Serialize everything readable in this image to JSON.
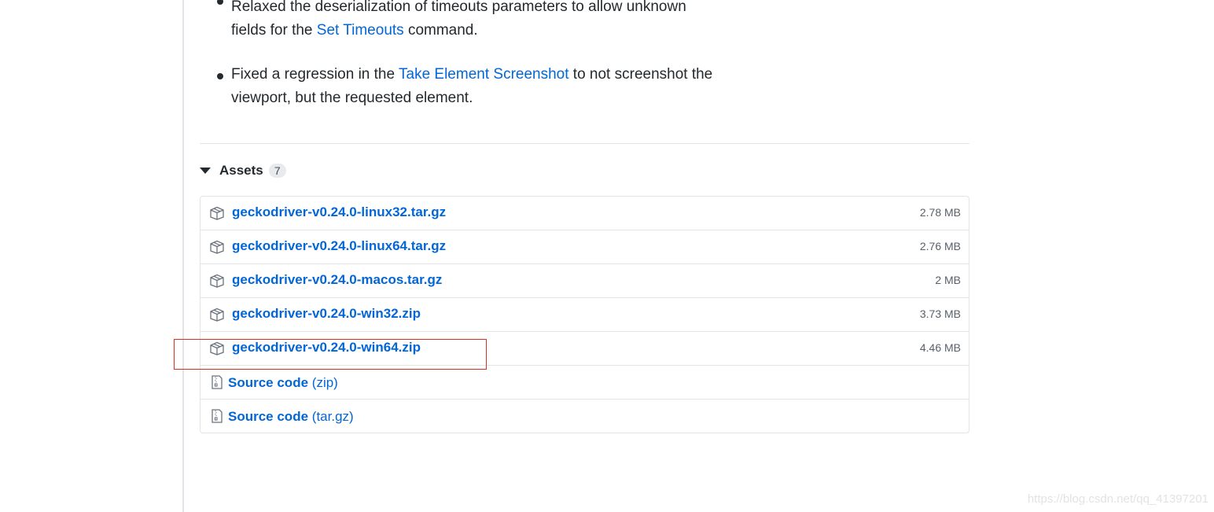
{
  "release_notes": {
    "items": [
      {
        "before": "Relaxed the deserialization of timeouts parameters to allow unknown fields for the ",
        "link": "Set Timeouts",
        "after": " command."
      },
      {
        "before": "Fixed a regression in the ",
        "link": "Take Element Screenshot",
        "after": " to not screenshot the viewport, but the requested element."
      }
    ]
  },
  "assets": {
    "title": "Assets",
    "count": "7",
    "files": [
      {
        "name": "geckodriver-v0.24.0-linux32.tar.gz",
        "size": "2.78 MB",
        "icon": "package-icon"
      },
      {
        "name": "geckodriver-v0.24.0-linux64.tar.gz",
        "size": "2.76 MB",
        "icon": "package-icon"
      },
      {
        "name": "geckodriver-v0.24.0-macos.tar.gz",
        "size": "2 MB",
        "icon": "package-icon"
      },
      {
        "name": "geckodriver-v0.24.0-win32.zip",
        "size": "3.73 MB",
        "icon": "package-icon"
      },
      {
        "name": "geckodriver-v0.24.0-win64.zip",
        "size": "4.46 MB",
        "icon": "package-icon"
      }
    ],
    "source_code": [
      {
        "label": "Source code",
        "ext": "(zip)",
        "icon": "file-zip-icon"
      },
      {
        "label": "Source code",
        "ext": "(tar.gz)",
        "icon": "file-zip-icon"
      }
    ]
  },
  "highlight": {
    "target": "geckodriver-v0.24.0-win64.zip",
    "color": "#d93025"
  },
  "watermark": "https://blog.csdn.net/qq_41397201",
  "colors": {
    "link": "#0366d6",
    "text": "#24292e",
    "muted": "#586069",
    "border": "#e1e4e8"
  }
}
